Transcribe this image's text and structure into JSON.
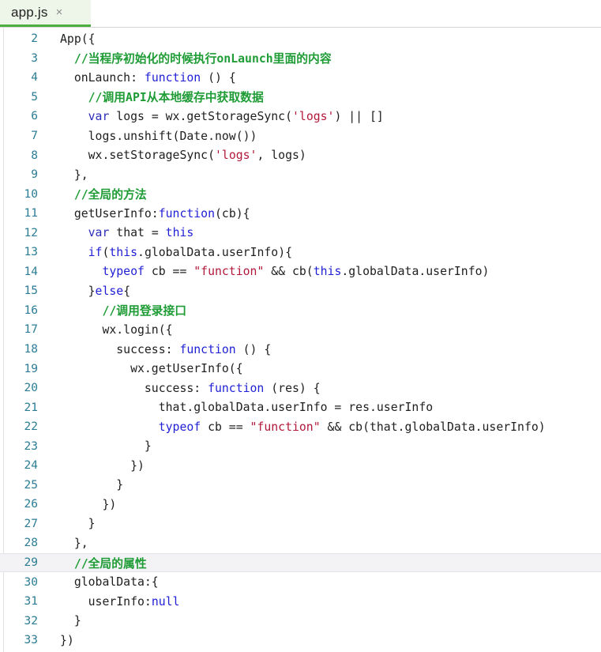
{
  "window": {
    "title": "app.js"
  },
  "tabbar": {
    "tabs": [
      {
        "label": "app.js",
        "close_icon": "close-icon",
        "close_glyph": "×",
        "active": true
      }
    ]
  },
  "editor": {
    "language": "javascript",
    "current_line": 29,
    "first_visible_line": 2,
    "last_visible_line": 33,
    "colors": {
      "background": "#ffffff",
      "tab_active_bg": "#eef6ea",
      "tab_active_underline": "#4caf3f",
      "line_number": "#2b7c94",
      "text": "#202020",
      "comment": "#1f9c36",
      "keyword": "#1f1fd6",
      "string": "#b3183a",
      "current_line_bg": "#f3f3f5"
    },
    "lines": [
      {
        "n": "2",
        "tokens": [
          {
            "t": "App({",
            "c": "plain"
          }
        ]
      },
      {
        "n": "3",
        "tokens": [
          {
            "t": "  //当程序初始化的时候执行onLaunch里面的内容",
            "c": "comment"
          }
        ]
      },
      {
        "n": "4",
        "tokens": [
          {
            "t": "  onLaunch: ",
            "c": "plain"
          },
          {
            "t": "function",
            "c": "keyword"
          },
          {
            "t": " () {",
            "c": "plain"
          }
        ]
      },
      {
        "n": "5",
        "tokens": [
          {
            "t": "    //调用API从本地缓存中获取数据",
            "c": "comment"
          }
        ]
      },
      {
        "n": "6",
        "tokens": [
          {
            "t": "    ",
            "c": "plain"
          },
          {
            "t": "var",
            "c": "kw2"
          },
          {
            "t": " logs = wx.getStorageSync(",
            "c": "plain"
          },
          {
            "t": "'logs'",
            "c": "string"
          },
          {
            "t": ") || []",
            "c": "plain"
          }
        ]
      },
      {
        "n": "7",
        "tokens": [
          {
            "t": "    logs.unshift(Date.now())",
            "c": "plain"
          }
        ]
      },
      {
        "n": "8",
        "tokens": [
          {
            "t": "    wx.setStorageSync(",
            "c": "plain"
          },
          {
            "t": "'logs'",
            "c": "string"
          },
          {
            "t": ", logs)",
            "c": "plain"
          }
        ]
      },
      {
        "n": "9",
        "tokens": [
          {
            "t": "  },",
            "c": "plain"
          }
        ]
      },
      {
        "n": "10",
        "tokens": [
          {
            "t": "  //全局的方法",
            "c": "comment"
          }
        ]
      },
      {
        "n": "11",
        "tokens": [
          {
            "t": "  getUserInfo:",
            "c": "plain"
          },
          {
            "t": "function",
            "c": "keyword"
          },
          {
            "t": "(cb){",
            "c": "plain"
          }
        ]
      },
      {
        "n": "12",
        "tokens": [
          {
            "t": "    ",
            "c": "plain"
          },
          {
            "t": "var",
            "c": "kw2"
          },
          {
            "t": " that = ",
            "c": "plain"
          },
          {
            "t": "this",
            "c": "keyword"
          }
        ]
      },
      {
        "n": "13",
        "tokens": [
          {
            "t": "    ",
            "c": "plain"
          },
          {
            "t": "if",
            "c": "keyword"
          },
          {
            "t": "(",
            "c": "plain"
          },
          {
            "t": "this",
            "c": "keyword"
          },
          {
            "t": ".globalData.userInfo){",
            "c": "plain"
          }
        ]
      },
      {
        "n": "14",
        "tokens": [
          {
            "t": "      ",
            "c": "plain"
          },
          {
            "t": "typeof",
            "c": "keyword"
          },
          {
            "t": " cb == ",
            "c": "plain"
          },
          {
            "t": "\"function\"",
            "c": "string"
          },
          {
            "t": " && cb(",
            "c": "plain"
          },
          {
            "t": "this",
            "c": "keyword"
          },
          {
            "t": ".globalData.userInfo)",
            "c": "plain"
          }
        ]
      },
      {
        "n": "15",
        "tokens": [
          {
            "t": "    }",
            "c": "plain"
          },
          {
            "t": "else",
            "c": "keyword"
          },
          {
            "t": "{",
            "c": "plain"
          }
        ]
      },
      {
        "n": "16",
        "tokens": [
          {
            "t": "      //调用登录接口",
            "c": "comment"
          }
        ]
      },
      {
        "n": "17",
        "tokens": [
          {
            "t": "      wx.login({",
            "c": "plain"
          }
        ]
      },
      {
        "n": "18",
        "tokens": [
          {
            "t": "        success: ",
            "c": "plain"
          },
          {
            "t": "function",
            "c": "keyword"
          },
          {
            "t": " () {",
            "c": "plain"
          }
        ]
      },
      {
        "n": "19",
        "tokens": [
          {
            "t": "          wx.getUserInfo({",
            "c": "plain"
          }
        ]
      },
      {
        "n": "20",
        "tokens": [
          {
            "t": "            success: ",
            "c": "plain"
          },
          {
            "t": "function",
            "c": "keyword"
          },
          {
            "t": " (res) {",
            "c": "plain"
          }
        ]
      },
      {
        "n": "21",
        "tokens": [
          {
            "t": "              that.globalData.userInfo = res.userInfo",
            "c": "plain"
          }
        ]
      },
      {
        "n": "22",
        "tokens": [
          {
            "t": "              ",
            "c": "plain"
          },
          {
            "t": "typeof",
            "c": "keyword"
          },
          {
            "t": " cb == ",
            "c": "plain"
          },
          {
            "t": "\"function\"",
            "c": "string"
          },
          {
            "t": " && cb(that.globalData.userInfo)",
            "c": "plain"
          }
        ]
      },
      {
        "n": "23",
        "tokens": [
          {
            "t": "            }",
            "c": "plain"
          }
        ]
      },
      {
        "n": "24",
        "tokens": [
          {
            "t": "          })",
            "c": "plain"
          }
        ]
      },
      {
        "n": "25",
        "tokens": [
          {
            "t": "        }",
            "c": "plain"
          }
        ]
      },
      {
        "n": "26",
        "tokens": [
          {
            "t": "      })",
            "c": "plain"
          }
        ]
      },
      {
        "n": "27",
        "tokens": [
          {
            "t": "    }",
            "c": "plain"
          }
        ]
      },
      {
        "n": "28",
        "tokens": [
          {
            "t": "  },",
            "c": "plain"
          }
        ]
      },
      {
        "n": "29",
        "tokens": [
          {
            "t": "  //全局的属性",
            "c": "comment"
          }
        ],
        "current": true
      },
      {
        "n": "30",
        "tokens": [
          {
            "t": "  globalData:{",
            "c": "plain"
          }
        ]
      },
      {
        "n": "31",
        "tokens": [
          {
            "t": "    userInfo:",
            "c": "plain"
          },
          {
            "t": "null",
            "c": "null"
          }
        ]
      },
      {
        "n": "32",
        "tokens": [
          {
            "t": "  }",
            "c": "plain"
          }
        ]
      },
      {
        "n": "33",
        "tokens": [
          {
            "t": "})",
            "c": "plain"
          }
        ]
      }
    ]
  }
}
